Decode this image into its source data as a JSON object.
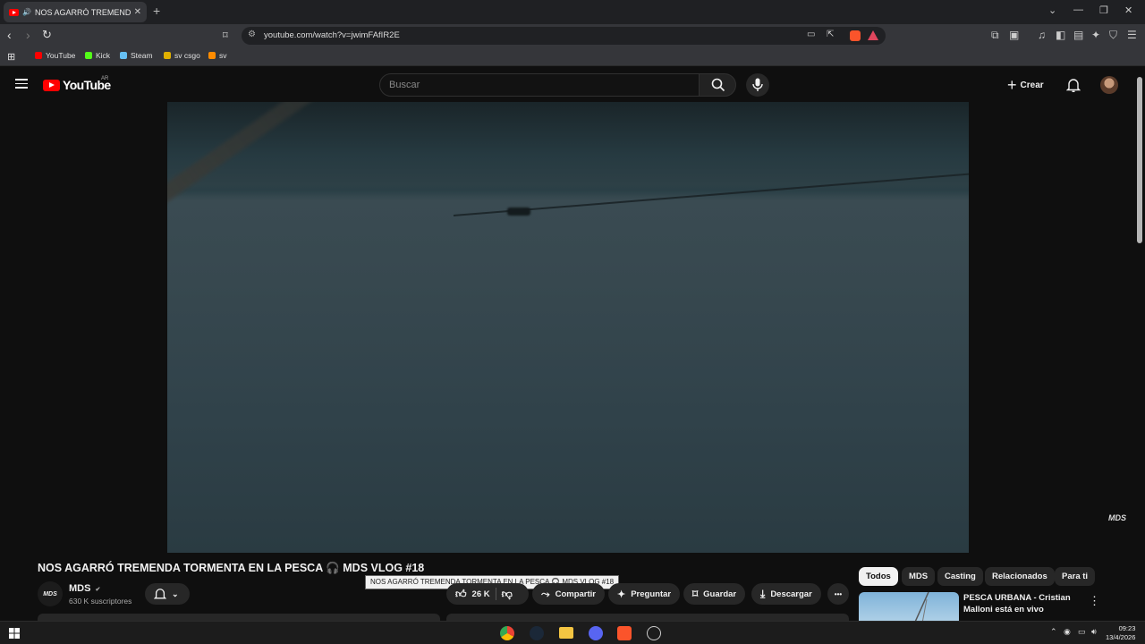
{
  "browser": {
    "tab_title": "NOS AGARRÓ TREMENDA TO",
    "tab_close": "✕",
    "new_tab": "+",
    "url": "youtube.com/watch?v=jwimFAfIR2E",
    "window_controls": [
      "⌄",
      "—",
      "❐",
      "✕"
    ],
    "bookmarks": [
      {
        "label": "YouTube",
        "color": "#ff0000"
      },
      {
        "label": "Kick",
        "color": "#53fc18"
      },
      {
        "label": "Steam",
        "color": "#66c0f4"
      },
      {
        "label": "sv csgo",
        "color": "#e0b000"
      },
      {
        "label": "sv",
        "color": "#ff8c00"
      }
    ]
  },
  "youtube": {
    "logo_text": "YouTube",
    "region": "AR",
    "search_placeholder": "Buscar",
    "create_label": "Crear",
    "video": {
      "title": "NOS AGARRÓ TREMENDA TORMENTA EN LA PESCA 🎧 MDS VLOG #18",
      "tooltip": "NOS AGARRÓ TREMENDA TORMENTA EN LA PESCA 🎧 MDS VLOG #18",
      "watermark": "MDS"
    },
    "channel": {
      "name": "MDS",
      "verified": "✔",
      "subscribers": "630 K suscriptores",
      "avatar_text": "MDS"
    },
    "actions": {
      "likes": "26 K",
      "share": "Compartir",
      "ask": "Preguntar",
      "save": "Guardar",
      "download": "Descargar",
      "more": "•••"
    },
    "chips": [
      "Todos",
      "MDS",
      "Casting",
      "Relacionados",
      "Para ti"
    ],
    "recommendation": {
      "title": "PESCA URBANA - Cristian Malloni está en vivo"
    }
  },
  "taskbar": {
    "time": "09:23",
    "date": "13/4/2026"
  }
}
